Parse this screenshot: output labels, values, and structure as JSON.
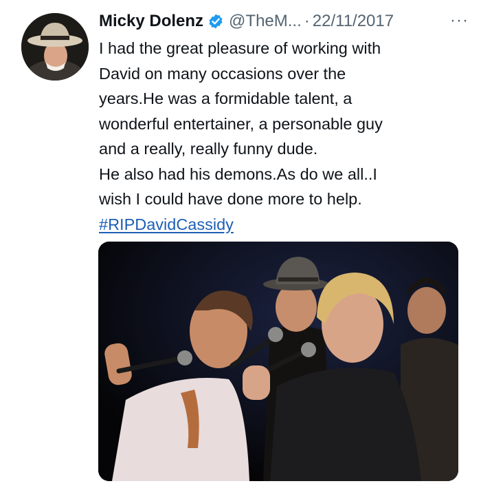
{
  "tweet": {
    "author_name": "Micky Dolenz",
    "handle": "@TheM...",
    "separator": "·",
    "date": "22/11/2017",
    "more_label": "···",
    "lines": [
      "I had the great pleasure of working with",
      "David on many occasions over the",
      "years.He was a formidable talent, a",
      "wonderful entertainer, a personable guy",
      "and a really, really funny dude.",
      "He also had his demons.As do we all..I",
      "wish I could have done more to help."
    ],
    "hashtag": "#RIPDavidCassidy"
  },
  "icons": {
    "verified": "verified-badge-icon",
    "more": "more-options-icon"
  },
  "colors": {
    "text": "#0f1419",
    "secondary": "#536471",
    "verified": "#1d9bf0",
    "hashtag": "#1d5fb5"
  }
}
